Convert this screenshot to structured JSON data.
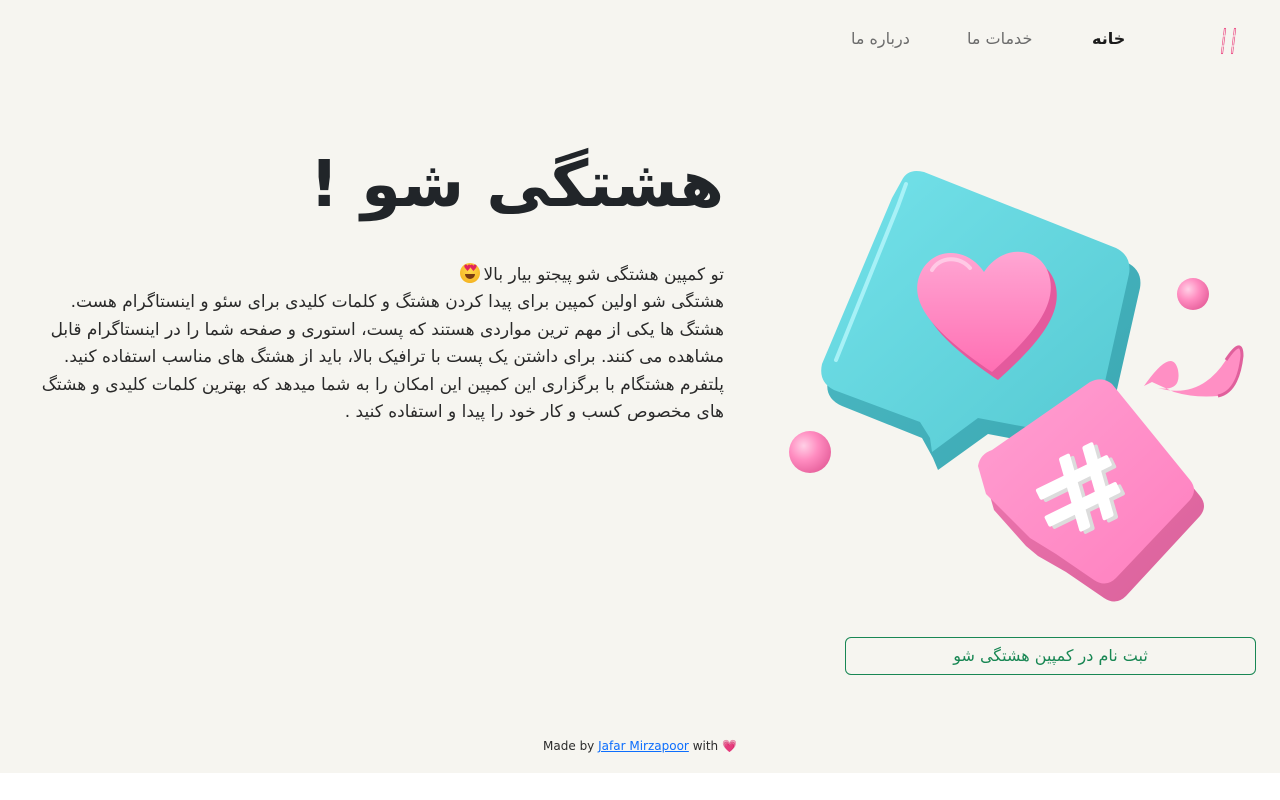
{
  "header": {
    "logo_icon": "hashtag-icon",
    "nav": {
      "home": "خانه",
      "services": "خدمات ما",
      "about": "درباره ما"
    }
  },
  "hero": {
    "title": "هشتگی شو !",
    "lines": [
      "تو کمپین هشتگی شو پیجتو بیار بالا",
      "هشتگی شو اولین کمپین برای پیدا کردن هشتگ و کلمات کلیدی برای سئو و اینستاگرام هست.",
      "هشتگ ها یکی از مهم ترین مواردی هستند که پست، استوری و صفحه شما را در اینستاگرام قابل",
      "مشاهده می کنند. برای داشتن یک پست با ترافیک بالا، باید از هشتگ های مناسب استفاده کنید.",
      "پلتفرم هشتگام با برگزاری این کمپین این امکان را به شما میدهد که بهترین کلمات کلیدی و هشتگ",
      "های مخصوص کسب و کار خود را پیدا و استفاده کنید ."
    ],
    "emoji": "heart-eyes-emoji"
  },
  "illustration": {
    "name": "hashtag-heart-chat-bubbles-illustration",
    "colors": {
      "cyan": "#5fd3dc",
      "pink": "#ff8cc6",
      "white": "#ffffff"
    }
  },
  "cta": {
    "label": "ثبت نام در کمپین هشتگی شو"
  },
  "footer": {
    "made_by": "Made by",
    "author": "Jafar Mirzapoor",
    "with": "with",
    "heart": "💗"
  },
  "colors": {
    "background": "#f6f5f0",
    "accent_green": "#198754",
    "link_blue": "#0d6efd",
    "brand_pink": "#e8407c"
  }
}
